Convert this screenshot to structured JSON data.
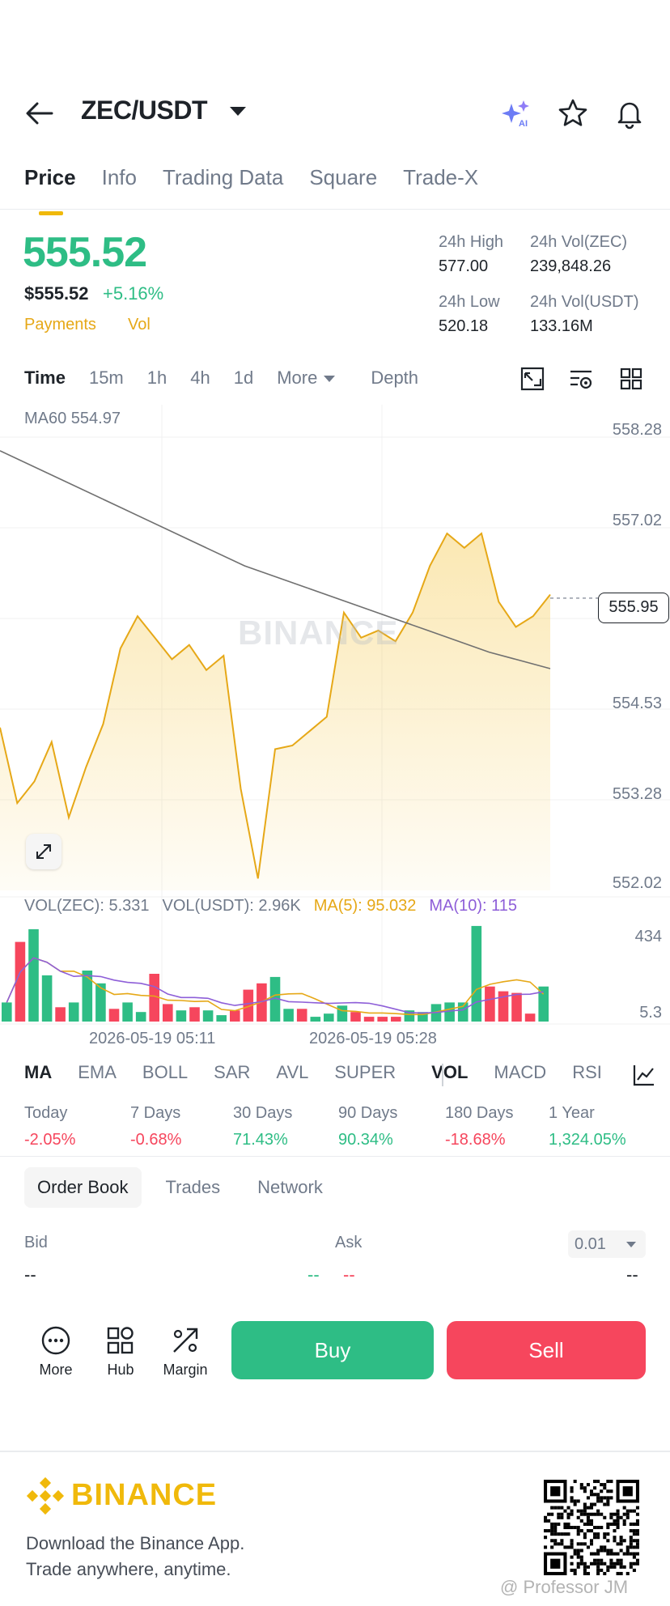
{
  "header": {
    "pair": "ZEC/USDT",
    "icons": [
      "back-arrow-icon",
      "ai-sparkle-icon",
      "star-icon",
      "bell-icon"
    ]
  },
  "tabs": [
    "Price",
    "Info",
    "Trading Data",
    "Square",
    "Trade-X"
  ],
  "price": {
    "last": "555.52",
    "usd": "$555.52",
    "change_pct": "+5.16%",
    "tag_payments": "Payments",
    "tag_vol": "Vol",
    "stats": {
      "high_label": "24h High",
      "high_value": "577.00",
      "low_label": "24h Low",
      "low_value": "520.18",
      "vol_base_label": "24h Vol(ZEC)",
      "vol_base_value": "239,848.26",
      "vol_quote_label": "24h Vol(USDT)",
      "vol_quote_value": "133.16M"
    }
  },
  "intervals": {
    "items": [
      "Time",
      "15m",
      "1h",
      "4h",
      "1d",
      "More",
      "Depth"
    ],
    "active": "Time",
    "tools": [
      "chart-type-icon",
      "chart-settings-icon",
      "grid-layout-icon"
    ]
  },
  "chart": {
    "ma60_label": "MA60 554.97",
    "y_ticks": [
      "558.28",
      "557.02",
      "555.95",
      "554.53",
      "553.28",
      "552.02"
    ],
    "last_price_marker": "555.95",
    "watermark": "BINANCE",
    "vol_legend": {
      "base": "VOL(ZEC): 5.331",
      "quote": "VOL(USDT): 2.96K",
      "ma5": "MA(5): 95.032",
      "ma10": "MA(10): 115"
    },
    "vol_ticks": [
      "434",
      "5.3"
    ],
    "x_ticks": [
      "2026-05-19 05:11",
      "2026-05-19 05:28"
    ]
  },
  "colors": {
    "green": "#2ebd85",
    "red": "#f6465d",
    "gold": "#f0b90b",
    "price_line": "#e6a817",
    "ma_line": "#707070",
    "ma10": "#8e5fd8"
  },
  "chart_data": {
    "type": "line",
    "price_series_approx": [
      554.15,
      553.1,
      553.4,
      553.95,
      552.9,
      553.6,
      554.2,
      555.25,
      555.7,
      555.4,
      555.1,
      555.3,
      554.95,
      555.15,
      553.3,
      552.05,
      553.85,
      553.9,
      554.1,
      554.3,
      555.75,
      555.4,
      555.5,
      555.35,
      555.75,
      556.4,
      556.85,
      556.65,
      556.85,
      555.9,
      555.55,
      555.7,
      556.0
    ],
    "ma60_series_approx": [
      558.0,
      557.6,
      557.2,
      556.8,
      556.4,
      556.1,
      555.8,
      555.5,
      555.2,
      554.97
    ],
    "ylim": [
      552.02,
      558.28
    ],
    "volume_bars": [
      {
        "v": 60,
        "c": "green"
      },
      {
        "v": 250,
        "c": "red"
      },
      {
        "v": 290,
        "c": "green"
      },
      {
        "v": 145,
        "c": "green"
      },
      {
        "v": 45,
        "c": "red"
      },
      {
        "v": 60,
        "c": "green"
      },
      {
        "v": 160,
        "c": "green"
      },
      {
        "v": 120,
        "c": "green"
      },
      {
        "v": 40,
        "c": "red"
      },
      {
        "v": 60,
        "c": "green"
      },
      {
        "v": 30,
        "c": "green"
      },
      {
        "v": 150,
        "c": "red"
      },
      {
        "v": 55,
        "c": "red"
      },
      {
        "v": 35,
        "c": "green"
      },
      {
        "v": 45,
        "c": "red"
      },
      {
        "v": 35,
        "c": "green"
      },
      {
        "v": 20,
        "c": "green"
      },
      {
        "v": 35,
        "c": "red"
      },
      {
        "v": 100,
        "c": "red"
      },
      {
        "v": 120,
        "c": "red"
      },
      {
        "v": 140,
        "c": "green"
      },
      {
        "v": 40,
        "c": "green"
      },
      {
        "v": 40,
        "c": "red"
      },
      {
        "v": 15,
        "c": "green"
      },
      {
        "v": 25,
        "c": "green"
      },
      {
        "v": 50,
        "c": "green"
      },
      {
        "v": 30,
        "c": "red"
      },
      {
        "v": 15,
        "c": "red"
      },
      {
        "v": 15,
        "c": "red"
      },
      {
        "v": 15,
        "c": "red"
      },
      {
        "v": 35,
        "c": "green"
      },
      {
        "v": 30,
        "c": "green"
      },
      {
        "v": 55,
        "c": "green"
      },
      {
        "v": 60,
        "c": "green"
      },
      {
        "v": 60,
        "c": "green"
      },
      {
        "v": 300,
        "c": "green"
      },
      {
        "v": 110,
        "c": "red"
      },
      {
        "v": 95,
        "c": "red"
      },
      {
        "v": 90,
        "c": "red"
      },
      {
        "v": 25,
        "c": "red"
      },
      {
        "v": 110,
        "c": "green"
      }
    ],
    "vol_ylim": [
      0,
      310
    ]
  },
  "indicators": {
    "items": [
      "MA",
      "EMA",
      "BOLL",
      "SAR",
      "AVL",
      "SUPER",
      "VOL",
      "MACD",
      "RSI"
    ],
    "active_main": "MA",
    "active_sub": "VOL"
  },
  "performance": [
    {
      "label": "Today",
      "value": "-2.05%",
      "dir": "down"
    },
    {
      "label": "7 Days",
      "value": "-0.68%",
      "dir": "down"
    },
    {
      "label": "30 Days",
      "value": "71.43%",
      "dir": "up"
    },
    {
      "label": "90 Days",
      "value": "90.34%",
      "dir": "up"
    },
    {
      "label": "180 Days",
      "value": "-18.68%",
      "dir": "down"
    },
    {
      "label": "1 Year",
      "value": "1,324.05%",
      "dir": "up"
    }
  ],
  "orderbook": {
    "tabs": [
      "Order Book",
      "Trades",
      "Network"
    ],
    "bid_label": "Bid",
    "ask_label": "Ask",
    "precision": "0.01",
    "placeholder": "--"
  },
  "actions": {
    "more": "More",
    "hub": "Hub",
    "margin": "Margin",
    "buy": "Buy",
    "sell": "Sell"
  },
  "footer": {
    "brand": "BINANCE",
    "line1": "Download the Binance App.",
    "line2": "Trade anywhere, anytime.",
    "credit": "@ Professor JM"
  }
}
